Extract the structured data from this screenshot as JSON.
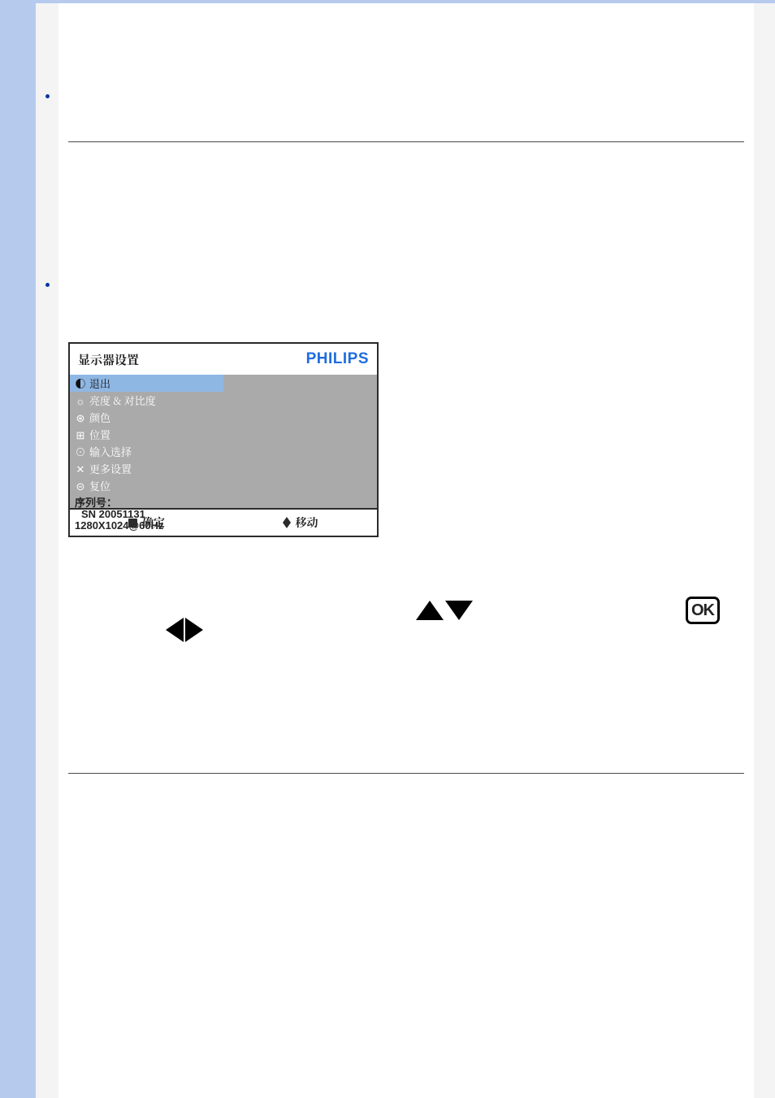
{
  "osd": {
    "title": "显示器设置",
    "brand": "PHILIPS",
    "menu": [
      {
        "glyph": "◐",
        "label": "退出",
        "selected": true
      },
      {
        "glyph": "☼",
        "label": "亮度 & 对比度",
        "selected": false
      },
      {
        "glyph": "⊛",
        "label": "颜色",
        "selected": false
      },
      {
        "glyph": "⊞",
        "label": "位置",
        "selected": false
      },
      {
        "glyph": "⊙",
        "label": "输入选择",
        "selected": false
      },
      {
        "glyph": "✕",
        "label": "更多设置",
        "selected": false
      },
      {
        "glyph": "⊝",
        "label": "复位",
        "selected": false
      }
    ],
    "serial_label": "序列号：",
    "serial_value": "SN 20051131",
    "resolution": "1280X1024@60Hz",
    "foot_ok": "确定",
    "foot_move": "移动"
  },
  "controls": {
    "ok_label": "OK"
  }
}
